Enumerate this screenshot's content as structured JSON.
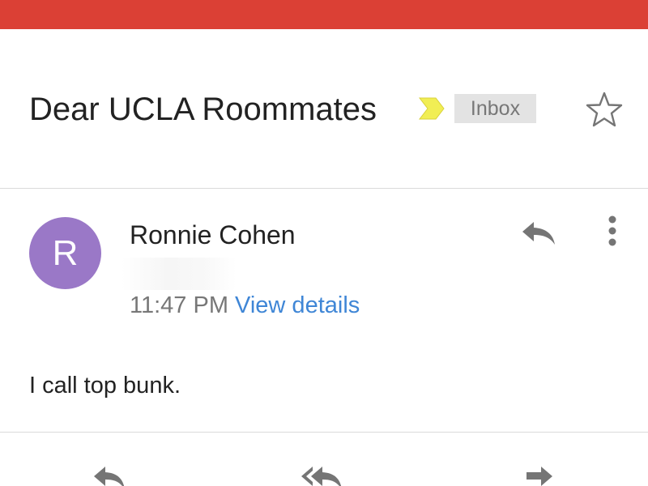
{
  "colors": {
    "top_bar": "#db4035",
    "divider": "#dadada",
    "avatar": "#9a78c7",
    "importance": "#f1ee54",
    "icon_gray": "#757575"
  },
  "subject": {
    "title": "Dear UCLA Roommates",
    "label": "Inbox",
    "importance_icon": "importance-marker-icon",
    "star_icon": "star-outline-icon"
  },
  "message": {
    "avatar_letter": "R",
    "sender": "Ronnie Cohen",
    "time": "11:47 PM",
    "view_details": "View details",
    "reply_icon": "reply-icon",
    "more_icon": "more-vert-icon",
    "body": "I call top bunk."
  },
  "actions": {
    "items": [
      {
        "icon": "reply-icon"
      },
      {
        "icon": "reply-all-icon"
      },
      {
        "icon": "forward-icon"
      }
    ]
  }
}
